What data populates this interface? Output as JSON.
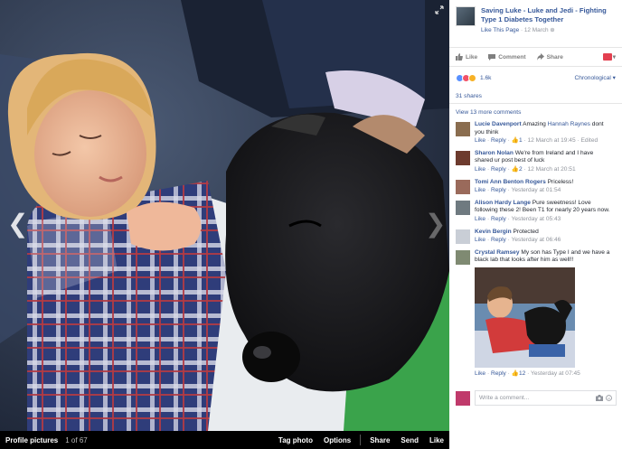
{
  "viewer": {
    "album": "Profile pictures",
    "position": "1 of 67",
    "actions": [
      "Tag photo",
      "Options",
      "Share",
      "Send",
      "Like"
    ],
    "prev_icon": "chevron-left-icon",
    "next_icon": "chevron-right-icon",
    "expand_icon": "expand-icon"
  },
  "post": {
    "page_name": "Saving Luke - Luke and Jedi - Fighting Type 1 Diabetes Together",
    "like_page": "Like This Page",
    "date": "12 March",
    "actions": {
      "like": "Like",
      "comment": "Comment",
      "share": "Share"
    },
    "reaction_count": "1.6k",
    "order": "Chronological",
    "shares": "31 shares",
    "more_comments": "View 13 more comments"
  },
  "comments": [
    {
      "name": "Lucie Davenport",
      "text": "Amazing",
      "mention": "Hannah Raynes",
      "text2": "dont you think",
      "like": "Like",
      "reply": "Reply",
      "likes": "1",
      "time": "12 March at 19:45",
      "extra": "Edited",
      "avatar": "#8a6d4f"
    },
    {
      "name": "Sharon Nolan",
      "text": "We're from Ireland and I have shared ur post best of luck",
      "like": "Like",
      "reply": "Reply",
      "likes": "2",
      "time": "12 March at 20:51",
      "avatar": "#6d3b2e"
    },
    {
      "name": "Tomi Ann Benton Rogers",
      "text": "Priceless!",
      "like": "Like",
      "reply": "Reply",
      "time": "Yesterday at 01:54",
      "avatar": "#9a6a5b"
    },
    {
      "name": "Alison Hardy Lange",
      "text": "Pure sweetness! Love following these 2! Been T1 for nearly 20 years now.",
      "like": "Like",
      "reply": "Reply",
      "time": "Yesterday at 05:43",
      "avatar": "#6f7a80"
    },
    {
      "name": "Kevin Bergin",
      "text": "Protected",
      "like": "Like",
      "reply": "Reply",
      "time": "Yesterday at 06:46",
      "avatar": "#c9ced6"
    },
    {
      "name": "Crystal Ramsey",
      "text": "My son has Type I and we have a black lab that looks after him as well!!",
      "like": "Like",
      "reply": "Reply",
      "likes": "12",
      "time": "Yesterday at 07:45",
      "avatar": "#7f8a72"
    }
  ],
  "composer": {
    "placeholder": "Write a comment..."
  },
  "colors": {
    "link": "#365899",
    "meta": "#90949c",
    "like_blue": "#5890ff",
    "love_red": "#f25268",
    "wow_yellow": "#f7b125"
  }
}
